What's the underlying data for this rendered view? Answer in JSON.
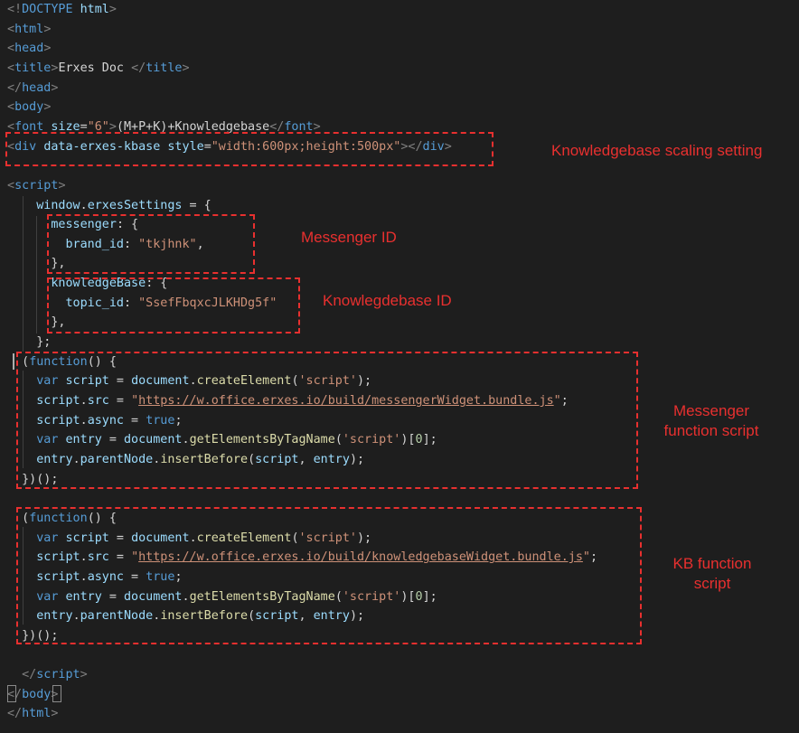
{
  "code_lines": [
    [
      [
        "t-punct",
        "<!"
      ],
      [
        "t-tag",
        "DOCTYPE"
      ],
      [
        "t-text",
        " "
      ],
      [
        "t-attr",
        "html"
      ],
      [
        "t-punct",
        ">"
      ]
    ],
    [
      [
        "t-punct",
        "<"
      ],
      [
        "t-tag",
        "html"
      ],
      [
        "t-punct",
        ">"
      ]
    ],
    [
      [
        "t-punct",
        "<"
      ],
      [
        "t-tag",
        "head"
      ],
      [
        "t-punct",
        ">"
      ]
    ],
    [
      [
        "t-punct",
        "<"
      ],
      [
        "t-tag",
        "title"
      ],
      [
        "t-punct",
        ">"
      ],
      [
        "t-text",
        "Erxes Doc "
      ],
      [
        "t-punct",
        "</"
      ],
      [
        "t-tag",
        "title"
      ],
      [
        "t-punct",
        ">"
      ]
    ],
    [
      [
        "t-punct",
        "</"
      ],
      [
        "t-tag",
        "head"
      ],
      [
        "t-punct",
        ">"
      ]
    ],
    [
      [
        "t-punct",
        "<"
      ],
      [
        "t-tag",
        "body"
      ],
      [
        "t-punct",
        ">"
      ]
    ],
    [
      [
        "t-punct",
        "<"
      ],
      [
        "t-tag",
        "font"
      ],
      [
        "t-text",
        " "
      ],
      [
        "t-attr",
        "size"
      ],
      [
        "t-op",
        "="
      ],
      [
        "t-str",
        "\"6\""
      ],
      [
        "t-punct",
        ">"
      ],
      [
        "t-text",
        "(M+P+K)+Knowledgebase"
      ],
      [
        "t-punct",
        "</"
      ],
      [
        "t-tag",
        "font"
      ],
      [
        "t-punct",
        ">"
      ]
    ],
    [
      [
        "t-punct",
        "<"
      ],
      [
        "t-tag",
        "div"
      ],
      [
        "t-text",
        " "
      ],
      [
        "t-attr",
        "data-erxes-kbase"
      ],
      [
        "t-text",
        " "
      ],
      [
        "t-attr",
        "style"
      ],
      [
        "t-op",
        "="
      ],
      [
        "t-str",
        "\"width:600px;height:500px\""
      ],
      [
        "t-punct",
        "></"
      ],
      [
        "t-tag",
        "div"
      ],
      [
        "t-punct",
        ">"
      ]
    ],
    [],
    [
      [
        "t-punct",
        "<"
      ],
      [
        "t-tag",
        "script"
      ],
      [
        "t-punct",
        ">"
      ]
    ],
    [
      [
        "t-text",
        "    "
      ],
      [
        "t-var",
        "window"
      ],
      [
        "t-op",
        "."
      ],
      [
        "t-var",
        "erxesSettings"
      ],
      [
        "t-op",
        " = {"
      ]
    ],
    [
      [
        "t-text",
        "      "
      ],
      [
        "t-var",
        "messenger"
      ],
      [
        "t-op",
        ": {"
      ]
    ],
    [
      [
        "t-text",
        "        "
      ],
      [
        "t-var",
        "brand_id"
      ],
      [
        "t-op",
        ": "
      ],
      [
        "t-str",
        "\"tkjhnk\""
      ],
      [
        "t-op",
        ","
      ]
    ],
    [
      [
        "t-text",
        "      "
      ],
      [
        "t-op",
        "},"
      ]
    ],
    [
      [
        "t-text",
        "      "
      ],
      [
        "t-var",
        "knowledgeBase"
      ],
      [
        "t-op",
        ": {"
      ]
    ],
    [
      [
        "t-text",
        "        "
      ],
      [
        "t-var",
        "topic_id"
      ],
      [
        "t-op",
        ": "
      ],
      [
        "t-str",
        "\"SsefFbqxcJLKHDg5f\""
      ]
    ],
    [
      [
        "t-text",
        "      "
      ],
      [
        "t-op",
        "},"
      ]
    ],
    [
      [
        "t-text",
        "    "
      ],
      [
        "t-op",
        "};"
      ]
    ],
    [
      [
        "t-text",
        "  "
      ],
      [
        "t-op",
        "("
      ],
      [
        "t-kw",
        "function"
      ],
      [
        "t-op",
        "() {"
      ]
    ],
    [
      [
        "t-text",
        "    "
      ],
      [
        "t-kw",
        "var"
      ],
      [
        "t-text",
        " "
      ],
      [
        "t-var",
        "script"
      ],
      [
        "t-op",
        " = "
      ],
      [
        "t-var",
        "document"
      ],
      [
        "t-op",
        "."
      ],
      [
        "t-func",
        "createElement"
      ],
      [
        "t-op",
        "("
      ],
      [
        "t-str",
        "'script'"
      ],
      [
        "t-op",
        ");"
      ]
    ],
    [
      [
        "t-text",
        "    "
      ],
      [
        "t-var",
        "script"
      ],
      [
        "t-op",
        "."
      ],
      [
        "t-prop",
        "src"
      ],
      [
        "t-op",
        " = "
      ],
      [
        "t-str",
        "\""
      ],
      [
        "t-url",
        "https://w.office.erxes.io/build/messengerWidget.bundle.js"
      ],
      [
        "t-str",
        "\""
      ],
      [
        "t-op",
        ";"
      ]
    ],
    [
      [
        "t-text",
        "    "
      ],
      [
        "t-var",
        "script"
      ],
      [
        "t-op",
        "."
      ],
      [
        "t-prop",
        "async"
      ],
      [
        "t-op",
        " = "
      ],
      [
        "t-kw",
        "true"
      ],
      [
        "t-op",
        ";"
      ]
    ],
    [
      [
        "t-text",
        "    "
      ],
      [
        "t-kw",
        "var"
      ],
      [
        "t-text",
        " "
      ],
      [
        "t-var",
        "entry"
      ],
      [
        "t-op",
        " = "
      ],
      [
        "t-var",
        "document"
      ],
      [
        "t-op",
        "."
      ],
      [
        "t-func",
        "getElementsByTagName"
      ],
      [
        "t-op",
        "("
      ],
      [
        "t-str",
        "'script'"
      ],
      [
        "t-op",
        ")["
      ],
      [
        "t-num",
        "0"
      ],
      [
        "t-op",
        "];"
      ]
    ],
    [
      [
        "t-text",
        "    "
      ],
      [
        "t-var",
        "entry"
      ],
      [
        "t-op",
        "."
      ],
      [
        "t-prop",
        "parentNode"
      ],
      [
        "t-op",
        "."
      ],
      [
        "t-func",
        "insertBefore"
      ],
      [
        "t-op",
        "("
      ],
      [
        "t-var",
        "script"
      ],
      [
        "t-op",
        ", "
      ],
      [
        "t-var",
        "entry"
      ],
      [
        "t-op",
        ");"
      ]
    ],
    [
      [
        "t-text",
        "  "
      ],
      [
        "t-op",
        "})();"
      ]
    ],
    [],
    [
      [
        "t-text",
        "  "
      ],
      [
        "t-op",
        "("
      ],
      [
        "t-kw",
        "function"
      ],
      [
        "t-op",
        "() {"
      ]
    ],
    [
      [
        "t-text",
        "    "
      ],
      [
        "t-kw",
        "var"
      ],
      [
        "t-text",
        " "
      ],
      [
        "t-var",
        "script"
      ],
      [
        "t-op",
        " = "
      ],
      [
        "t-var",
        "document"
      ],
      [
        "t-op",
        "."
      ],
      [
        "t-func",
        "createElement"
      ],
      [
        "t-op",
        "("
      ],
      [
        "t-str",
        "'script'"
      ],
      [
        "t-op",
        ");"
      ]
    ],
    [
      [
        "t-text",
        "    "
      ],
      [
        "t-var",
        "script"
      ],
      [
        "t-op",
        "."
      ],
      [
        "t-prop",
        "src"
      ],
      [
        "t-op",
        " = "
      ],
      [
        "t-str",
        "\""
      ],
      [
        "t-url",
        "https://w.office.erxes.io/build/knowledgebaseWidget.bundle.js"
      ],
      [
        "t-str",
        "\""
      ],
      [
        "t-op",
        ";"
      ]
    ],
    [
      [
        "t-text",
        "    "
      ],
      [
        "t-var",
        "script"
      ],
      [
        "t-op",
        "."
      ],
      [
        "t-prop",
        "async"
      ],
      [
        "t-op",
        " = "
      ],
      [
        "t-kw",
        "true"
      ],
      [
        "t-op",
        ";"
      ]
    ],
    [
      [
        "t-text",
        "    "
      ],
      [
        "t-kw",
        "var"
      ],
      [
        "t-text",
        " "
      ],
      [
        "t-var",
        "entry"
      ],
      [
        "t-op",
        " = "
      ],
      [
        "t-var",
        "document"
      ],
      [
        "t-op",
        "."
      ],
      [
        "t-func",
        "getElementsByTagName"
      ],
      [
        "t-op",
        "("
      ],
      [
        "t-str",
        "'script'"
      ],
      [
        "t-op",
        ")["
      ],
      [
        "t-num",
        "0"
      ],
      [
        "t-op",
        "];"
      ]
    ],
    [
      [
        "t-text",
        "    "
      ],
      [
        "t-var",
        "entry"
      ],
      [
        "t-op",
        "."
      ],
      [
        "t-prop",
        "parentNode"
      ],
      [
        "t-op",
        "."
      ],
      [
        "t-func",
        "insertBefore"
      ],
      [
        "t-op",
        "("
      ],
      [
        "t-var",
        "script"
      ],
      [
        "t-op",
        ", "
      ],
      [
        "t-var",
        "entry"
      ],
      [
        "t-op",
        ");"
      ]
    ],
    [
      [
        "t-text",
        "  "
      ],
      [
        "t-op",
        "})();"
      ]
    ],
    [],
    [
      [
        "t-text",
        "  "
      ],
      [
        "t-punct",
        "</"
      ],
      [
        "t-tag",
        "script"
      ],
      [
        "t-punct",
        ">"
      ]
    ],
    [
      [
        "t-punct",
        "</"
      ],
      [
        "t-tag",
        "body"
      ],
      [
        "t-punct",
        ">"
      ]
    ],
    [
      [
        "t-punct",
        "</"
      ],
      [
        "t-tag",
        "html"
      ],
      [
        "t-punct",
        ">"
      ]
    ]
  ],
  "annotations": {
    "kb_scaling": "Knowledgebase scaling setting",
    "messenger_id": "Messenger ID",
    "kb_id": "Knowlegdebase  ID",
    "messenger_script_1": "Messenger",
    "messenger_script_2": "function script",
    "kb_script_1": "KB function",
    "kb_script_2": "script"
  },
  "colors": {
    "background": "#1e1e1e",
    "annotation": "#e8302f",
    "tag": "#569cd6",
    "attribute": "#9cdcfe",
    "string": "#ce9178",
    "function": "#dcdcaa",
    "number": "#b5cea8"
  }
}
